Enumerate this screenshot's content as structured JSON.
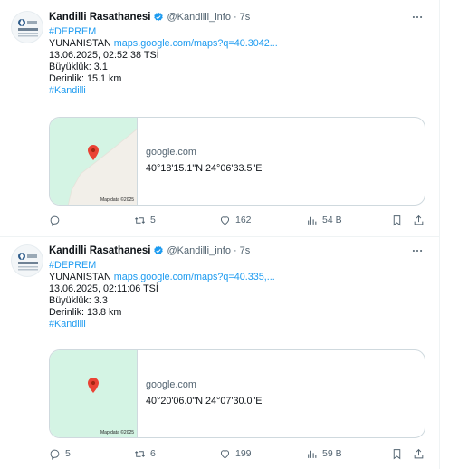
{
  "tweets": [
    {
      "name": "Kandilli Rasathanesi",
      "handle": "@Kandilli_info",
      "dot": "·",
      "time": "7s",
      "hashtag_top": "#DEPREM",
      "location_label": "YUNANISTAN",
      "maps_link": "maps.google.com/maps?q=40.3042...",
      "datetime": "13.06.2025, 02:52:38 TSİ",
      "magnitude": "Büyüklük: 3.1",
      "depth": "Derinlik: 15.1 km",
      "hashtag_bottom": "#Kandilli",
      "card": {
        "domain": "google.com",
        "title": "40°18'15.1\"N 24°06'33.5\"E",
        "map_credit": "Map data ©2025"
      },
      "stats": {
        "replies": "",
        "retweets": "5",
        "likes": "162",
        "views": "54 B"
      }
    },
    {
      "name": "Kandilli Rasathanesi",
      "handle": "@Kandilli_info",
      "dot": "·",
      "time": "7s",
      "hashtag_top": "#DEPREM",
      "location_label": "YUNANISTAN",
      "maps_link": "maps.google.com/maps?q=40.335,...",
      "datetime": "13.06.2025, 02:11:06 TSİ",
      "magnitude": "Büyüklük: 3.3",
      "depth": "Derinlik: 13.8 km",
      "hashtag_bottom": "#Kandilli",
      "card": {
        "domain": "google.com",
        "title": "40°20'06.0\"N 24°07'30.0\"E",
        "map_credit": "Map data ©2025"
      },
      "stats": {
        "replies": "5",
        "retweets": "6",
        "likes": "199",
        "views": "59 B"
      }
    }
  ],
  "colors": {
    "accent": "#1d9bf0",
    "muted": "#536471",
    "border": "#cfd9de",
    "map_land": "#f2efe9",
    "map_water": "#d4f4e4",
    "pin": "#ea4335"
  },
  "icons": [
    "verified-badge-icon",
    "more-icon",
    "reply-icon",
    "retweet-icon",
    "like-icon",
    "views-icon",
    "bookmark-icon",
    "share-icon",
    "map-pin-icon"
  ]
}
